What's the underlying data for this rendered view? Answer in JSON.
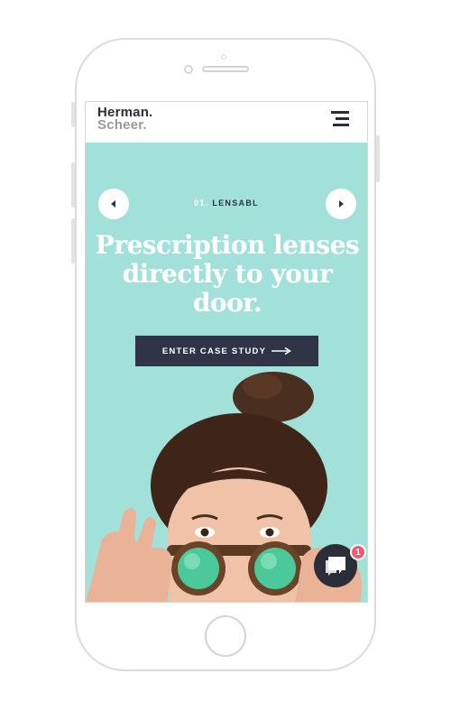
{
  "header": {
    "logo_line1": "Herman.",
    "logo_line2": "Scheer.",
    "menu_icon": "hamburger-menu-icon"
  },
  "slider": {
    "number": "01.",
    "label": "LENSABL",
    "prev_icon": "chevron-left-icon",
    "next_icon": "chevron-right-icon"
  },
  "hero": {
    "headline_line1": "Prescription lenses",
    "headline_line2": "directly to your",
    "headline_line3": "door.",
    "cta_label": "ENTER CASE STUDY",
    "cta_icon": "arrow-right-icon",
    "background_color": "#a1e1da"
  },
  "chat": {
    "icon": "chat-bubble-icon",
    "badge_count": "1"
  },
  "colors": {
    "dark": "#2f3446",
    "badge": "#ef5a72",
    "accent": "#a1e1da"
  }
}
